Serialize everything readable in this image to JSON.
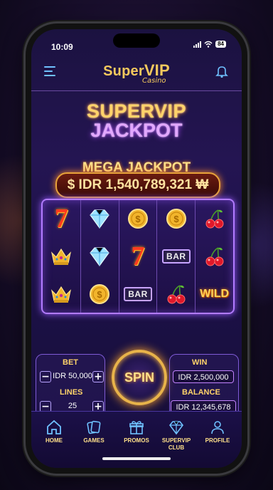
{
  "status": {
    "time": "10:09",
    "battery": "84"
  },
  "header": {
    "brand_main": "Super",
    "brand_vip": "VIP",
    "brand_sub": "Casino"
  },
  "jackpot": {
    "line1": "SUPERVIP",
    "line2": "JACKPOT",
    "mega_label": "MEGA JACKPOT",
    "amount": "$ IDR 1,540,789,321 ₩"
  },
  "reels": [
    [
      "seven",
      "diamond",
      "coin",
      "coin",
      "cherry"
    ],
    [
      "crown",
      "diamond",
      "seven",
      "bar",
      "cherry"
    ],
    [
      "crown",
      "coin",
      "bar",
      "cherry",
      "wild"
    ]
  ],
  "symbols": {
    "bar": "BAR",
    "wild": "WILD"
  },
  "controls": {
    "bet_label": "BET",
    "bet_value": "IDR 50,000",
    "lines_label": "LINES",
    "lines_value": "25",
    "win_label": "WIN",
    "win_value": "IDR 2,500,000",
    "balance_label": "BALANCE",
    "balance_value": "IDR 12,345,678",
    "spin_label": "SPIN",
    "minus": "−",
    "plus": "+"
  },
  "tabs": [
    {
      "label": "HOME"
    },
    {
      "label": "GAMES"
    },
    {
      "label": "PROMOS"
    },
    {
      "label": "SUPERVIP CLUB"
    },
    {
      "label": "PROFILE"
    }
  ],
  "colors": {
    "accent_gold": "#f4c95d",
    "accent_purple": "#b27bff",
    "accent_blue": "#6fc1ff"
  }
}
